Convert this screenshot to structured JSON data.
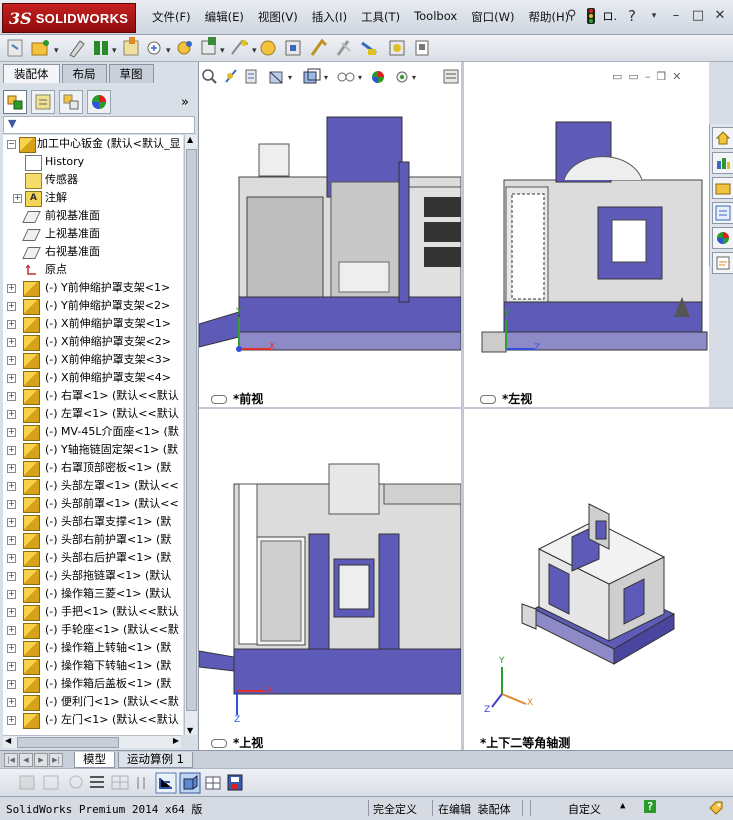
{
  "app": {
    "logo_ds": "3S",
    "logo_name": "SOLIDWORKS",
    "menu": [
      "文件(F)",
      "编辑(E)",
      "视图(V)",
      "插入(I)",
      "工具(T)",
      "Toolbox",
      "窗口(W)",
      "帮助(H)"
    ],
    "title_right_text": "ロ.",
    "help_glyph": "?"
  },
  "panel": {
    "tabs": [
      "装配体",
      "布局",
      "草图"
    ],
    "active_tab": 0,
    "expand_glyph": "»"
  },
  "tree": {
    "root": "加工中心钣金  (默认<默认_显",
    "fixed": [
      {
        "label": "History",
        "icon": "history-icon",
        "expandable": false
      },
      {
        "label": "传感器",
        "icon": "sensor-icon",
        "expandable": false
      },
      {
        "label": "注解",
        "icon": "annotation-icon",
        "expandable": true
      },
      {
        "label": "前视基准面",
        "icon": "plane-icon",
        "expandable": false
      },
      {
        "label": "上视基准面",
        "icon": "plane-icon",
        "expandable": false
      },
      {
        "label": "右视基准面",
        "icon": "plane-icon",
        "expandable": false
      },
      {
        "label": "原点",
        "icon": "origin-icon",
        "expandable": false
      }
    ],
    "components": [
      "(-) Y前伸缩护罩支架<1>",
      "(-) Y前伸缩护罩支架<2>",
      "(-) X前伸缩护罩支架<1>",
      "(-) X前伸缩护罩支架<2>",
      "(-) X前伸缩护罩支架<3>",
      "(-) X前伸缩护罩支架<4>",
      "(-) 右罩<1> (默认<<默认",
      "(-) 左罩<1> (默认<<默认",
      "(-) MV-45L介面座<1> (默",
      "(-) Y轴拖链固定架<1> (默",
      "(-) 右罩顶部密板<1> (默",
      "(-) 头部左罩<1> (默认<<",
      "(-) 头部前罩<1> (默认<<",
      "(-) 头部右罩支撑<1> (默",
      "(-) 头部右前护罩<1> (默",
      "(-) 头部右后护罩<1> (默",
      "(-) 头部拖链罩<1> (默认",
      "(-) 操作箱三菱<1> (默认",
      "(-) 手把<1> (默认<<默认",
      "(-) 手轮座<1> (默认<<默",
      "(-) 操作箱上转轴<1> (默",
      "(-) 操作箱下转轴<1> (默",
      "(-) 操作箱后盖板<1> (默",
      "(-) 便利门<1> (默认<<默",
      "(-) 左门<1> (默认<<默认"
    ]
  },
  "viewports": {
    "front": "*前视",
    "left": "*左视",
    "top": "*上视",
    "iso": "*上下二等角轴测"
  },
  "axes": {
    "x": "X",
    "y": "Y",
    "z": "Z"
  },
  "bottom_tabs": [
    "模型",
    "运动算例 1"
  ],
  "active_bottom_tab": 0,
  "status": {
    "product": "SolidWorks Premium 2014 x64 版",
    "definition": "完全定义",
    "editing": "在编辑 装配体",
    "units": "自定义",
    "help": "?"
  },
  "colors": {
    "machine_blue": "#5e5ab8",
    "machine_grey": "#d9d9d9",
    "machine_dark": "#3c3c50",
    "axis_x": "#e03030",
    "axis_y": "#30a030",
    "axis_z": "#3050e0",
    "axis_iso_x": "#e08a30",
    "axis_iso_y": "#2aa02a",
    "axis_iso_z": "#4040d0"
  }
}
